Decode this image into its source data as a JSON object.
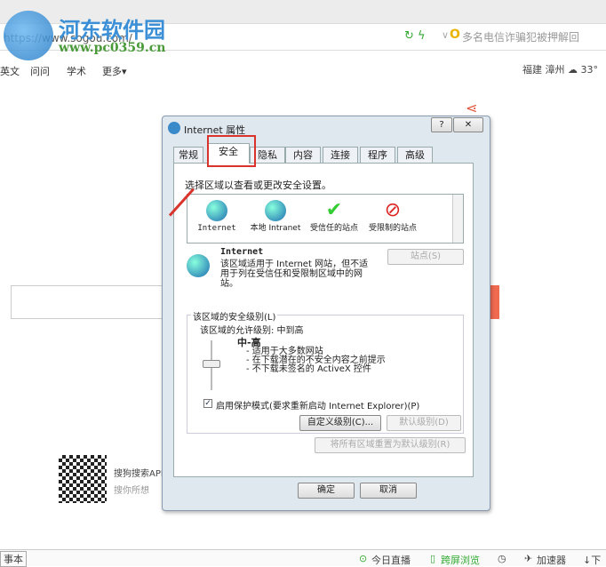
{
  "watermark": {
    "title": "河东软件园",
    "url": "www.pc0359.cn"
  },
  "browser": {
    "url": "https://www.sogou.com/",
    "news_ticker": "多名电信诈骗犯被押解回",
    "nav_links": [
      "英文",
      "问问",
      "学术",
      "更多▾"
    ],
    "weather": "福建 漳州 ☁ 33°"
  },
  "dialog": {
    "title": "Internet 属性",
    "help": "?",
    "close": "✕",
    "tabs": [
      "常规",
      "安全",
      "隐私",
      "内容",
      "连接",
      "程序",
      "高级"
    ],
    "instruction": "选择区域以查看或更改安全设置。",
    "zones": [
      {
        "label": "Internet"
      },
      {
        "label": "本地 Intranet"
      },
      {
        "label": "受信任的站点"
      },
      {
        "label": "受限制的站点"
      }
    ],
    "zone_name": "Internet",
    "sites_button": "站点(S)",
    "zone_desc": "该区域适用于 Internet 网站，但不适用于列在受信任和受限制区域中的网站。",
    "level_group": "该区域的安全级别(L)",
    "allowed": "该区域的允许级别: 中到高",
    "level_name": "中-高",
    "level_points": [
      "- 适用于大多数网站",
      "- 在下载潜在的不安全内容之前提示",
      "- 不下载未签名的 ActiveX 控件"
    ],
    "protected_mode": "启用保护模式(要求重新启动 Internet Explorer)(P)",
    "protected_checked": true,
    "custom_level": "自定义级别(C)...",
    "default_level": "默认级别(D)",
    "reset_all": "将所有区域重置为默认级别(R)",
    "ok": "确定",
    "cancel": "取消"
  },
  "app_promo": {
    "title": "搜狗搜索APP",
    "subtitle": "搜你所想"
  },
  "status": {
    "left": "事本",
    "items": [
      "今日直播",
      "跨屏浏览",
      "加速器",
      "下"
    ]
  },
  "colors": {
    "highlight": "#d9332b",
    "accent": "#3a8fd6"
  }
}
